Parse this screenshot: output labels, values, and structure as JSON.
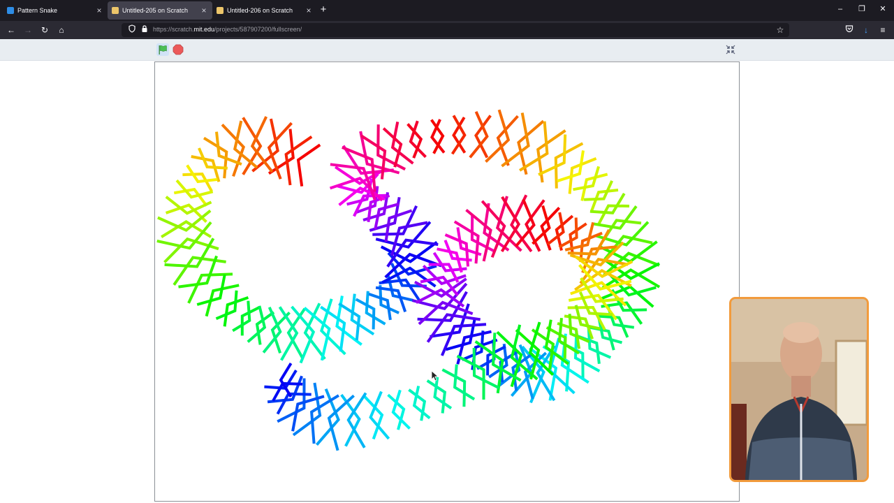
{
  "tabs": [
    {
      "title": "Pattern Snake",
      "favicon_color": "#2e8de6",
      "active": false
    },
    {
      "title": "Untitled-205 on Scratch",
      "favicon_color": "#ecc56a",
      "active": true
    },
    {
      "title": "Untitled-206 on Scratch",
      "favicon_color": "#ecc56a",
      "active": false
    }
  ],
  "tab_close_glyph": "×",
  "new_tab_glyph": "+",
  "window_controls": {
    "minimize": "–",
    "restore": "❐",
    "close": "✕"
  },
  "nav": {
    "back": "←",
    "forward": "→",
    "reload": "↻",
    "home": "⌂",
    "url_prefix": "https://scratch.",
    "url_host": "mit.edu",
    "url_path": "/projects/587907200/fullscreen/",
    "bookmark": "☆",
    "pocket": "◡",
    "downloads": "↓",
    "menu": "≡"
  },
  "icons": {
    "green_flag": "green-flag-icon",
    "stop": "stop-sign-icon",
    "exit_fullscreen": "exit-fullscreen-icon"
  },
  "colors": {
    "tabstrip_bg": "#1c1b22",
    "navbar_bg": "#2b2a33",
    "scratch_header_bg": "#e8edf1",
    "green_flag": "#4cbf56",
    "stop": "#ec5959",
    "webcam_border": "#f29b3c"
  }
}
